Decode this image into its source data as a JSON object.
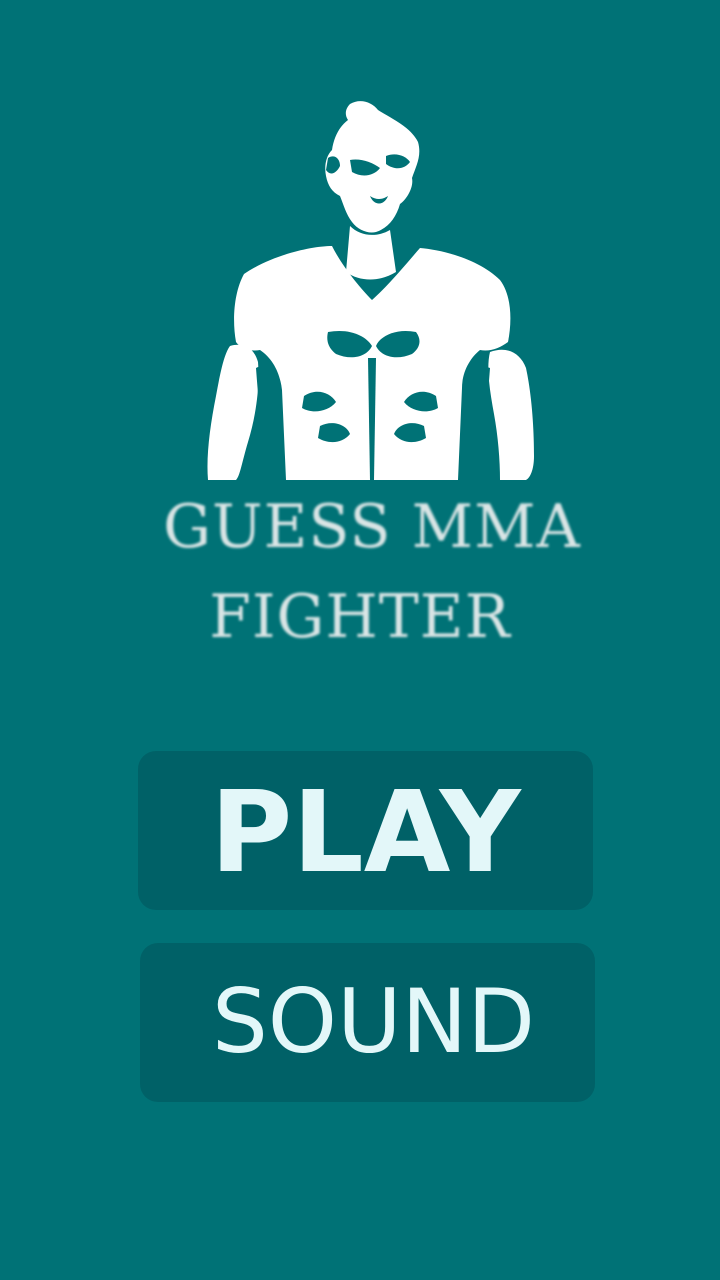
{
  "app": {
    "title_line_1": "GUESS MMA",
    "title_line_2": "FIGHTER",
    "logo_icon": "fighter-silhouette-icon",
    "background_color": "#007276"
  },
  "menu": {
    "play_label": "PLAY",
    "sound_label": "SOUND",
    "button_color": "#006167",
    "button_text_color": "#e3f7f9"
  }
}
